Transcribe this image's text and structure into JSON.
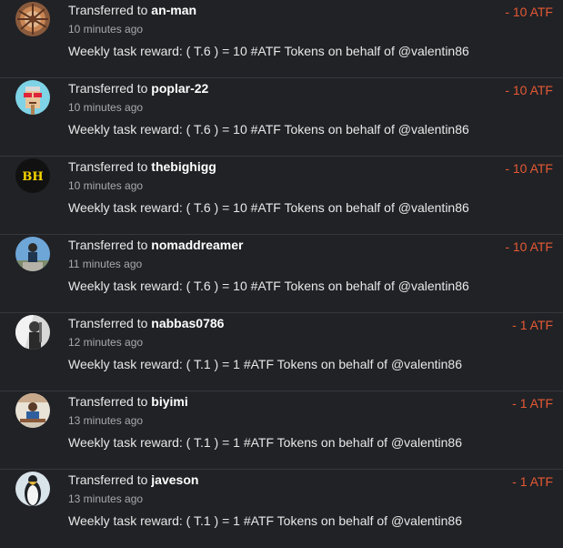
{
  "colors": {
    "background": "#212226",
    "amount_negative": "#e55934",
    "secondary_text": "#a7a9ad"
  },
  "transfers": [
    {
      "prefix": "Transferred to",
      "user": "an-man",
      "time": "10 minutes ago",
      "memo": "Weekly task reward: ( T.6 ) = 10 #ATF Tokens on behalf of @valentin86",
      "amount": "- 10 ATF",
      "avatar": "orange-pattern-avatar"
    },
    {
      "prefix": "Transferred to",
      "user": "poplar-22",
      "time": "10 minutes ago",
      "memo": "Weekly task reward: ( T.6 ) = 10 #ATF Tokens on behalf of @valentin86",
      "amount": "- 10 ATF",
      "avatar": "pixel-character-avatar"
    },
    {
      "prefix": "Transferred to",
      "user": "thebighigg",
      "time": "10 minutes ago",
      "memo": "Weekly task reward: ( T.6 ) = 10 #ATF Tokens on behalf of @valentin86",
      "amount": "- 10 ATF",
      "avatar": "bh-logo-avatar",
      "avatar_text": "BH"
    },
    {
      "prefix": "Transferred to",
      "user": "nomaddreamer",
      "time": "11 minutes ago",
      "memo": "Weekly task reward: ( T.6 ) = 10 #ATF Tokens on behalf of @valentin86",
      "amount": "- 10 ATF",
      "avatar": "person-outdoors-avatar"
    },
    {
      "prefix": "Transferred to",
      "user": "nabbas0786",
      "time": "12 minutes ago",
      "memo": "Weekly task reward: ( T.1 ) = 1 #ATF Tokens on behalf of @valentin86",
      "amount": "- 1 ATF",
      "avatar": "grayscale-person-avatar"
    },
    {
      "prefix": "Transferred to",
      "user": "biyimi",
      "time": "13 minutes ago",
      "memo": "Weekly task reward: ( T.1 ) = 1 #ATF Tokens on behalf of @valentin86",
      "amount": "- 1 ATF",
      "avatar": "person-at-desk-avatar"
    },
    {
      "prefix": "Transferred to",
      "user": "javeson",
      "time": "13 minutes ago",
      "memo": "Weekly task reward: ( T.1 ) = 1 #ATF Tokens on behalf of @valentin86",
      "amount": "- 1 ATF",
      "avatar": "penguin-avatar"
    }
  ]
}
